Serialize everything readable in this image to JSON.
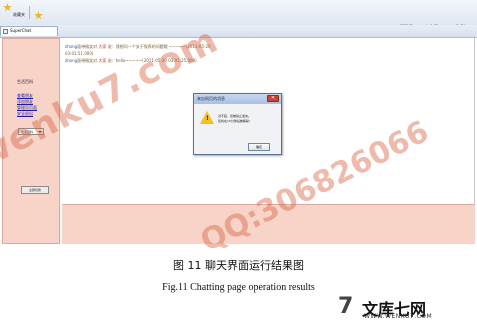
{
  "browser": {
    "favorites_label": "收藏夹",
    "tab_label": "SuperChat",
    "commands": {
      "page": "页面(P)",
      "safety": "安全(S)",
      "tools": "工具(O)"
    }
  },
  "sidebar": {
    "title": "生活百科",
    "links": [
      "查看朋友",
      "添加朋友",
      "管理员页面",
      "安全退出"
    ],
    "select_value": "生活百科",
    "button_label": "主题切换"
  },
  "chat": {
    "messages": [
      {
        "speaker": "zhong",
        "verb": "面带微笑",
        "target": "大家",
        "text": "说：我想问一个关于保养的问题哦 ~~~~~(2011-05-20",
        "time_line": "03:01:51.000)"
      },
      {
        "speaker": "zhong",
        "verb": "面带微笑",
        "target": "大家",
        "text": "说：hello~~~~~(2011-05-20 03:01:25.000)"
      }
    ]
  },
  "dialog": {
    "title": "来自网页的消息",
    "close_label": "✕",
    "message_lines": [
      "对不起，您被禁止发言。",
      "您将在10分钟后被解禁!"
    ],
    "ok_label": "确定"
  },
  "figure": {
    "caption_cn": "图 11  聊天界面运行结果图",
    "caption_en": "Fig.11 Chatting page operation results"
  },
  "watermark": {
    "main": "wenku7.com",
    "qq": "QQ:306826066",
    "logo_mark": "7",
    "logo_text": "文库七网",
    "logo_url": "WWW.WENKU7.COM"
  },
  "colors": {
    "panel_bg": "#f7d3c8",
    "link": "#1a1aa6",
    "watermark": "#d66544"
  }
}
